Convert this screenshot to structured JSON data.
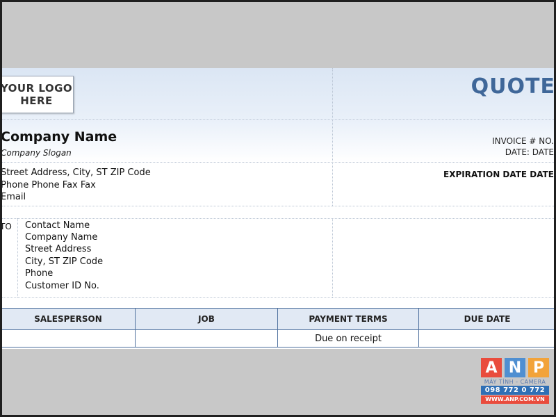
{
  "logo": {
    "text": "YOUR LOGO\nHERE"
  },
  "title": "QUOTE",
  "company": {
    "name": "Company Name",
    "slogan": "Company Slogan",
    "address_line": "Street Address, City, ST ZIP Code",
    "phone_fax_line": "Phone Phone Fax Fax",
    "email": "Email"
  },
  "meta": {
    "invoice_no": "INVOICE # NO.",
    "date": "DATE: DATE",
    "expiration": "EXPIRATION DATE DATE"
  },
  "to": {
    "label": "TO",
    "lines": [
      "Contact Name",
      "Company Name",
      "Street Address",
      "City, ST ZIP Code",
      "Phone",
      "Customer ID No."
    ]
  },
  "info_table": {
    "headers": [
      "SALESPERSON",
      "JOB",
      "PAYMENT TERMS",
      "DUE DATE"
    ],
    "row": [
      "",
      "",
      "Due on receipt",
      ""
    ]
  },
  "watermark": {
    "letters": [
      "A",
      "N",
      "P"
    ],
    "subtitle": "MÁY TÍNH - CAMERA",
    "phone": "098 772 0 772",
    "website": "WWW.ANP.COM.VN",
    "colors": {
      "a": "#e94c3d",
      "n": "#4f8fd1",
      "p": "#f2a33a"
    }
  }
}
